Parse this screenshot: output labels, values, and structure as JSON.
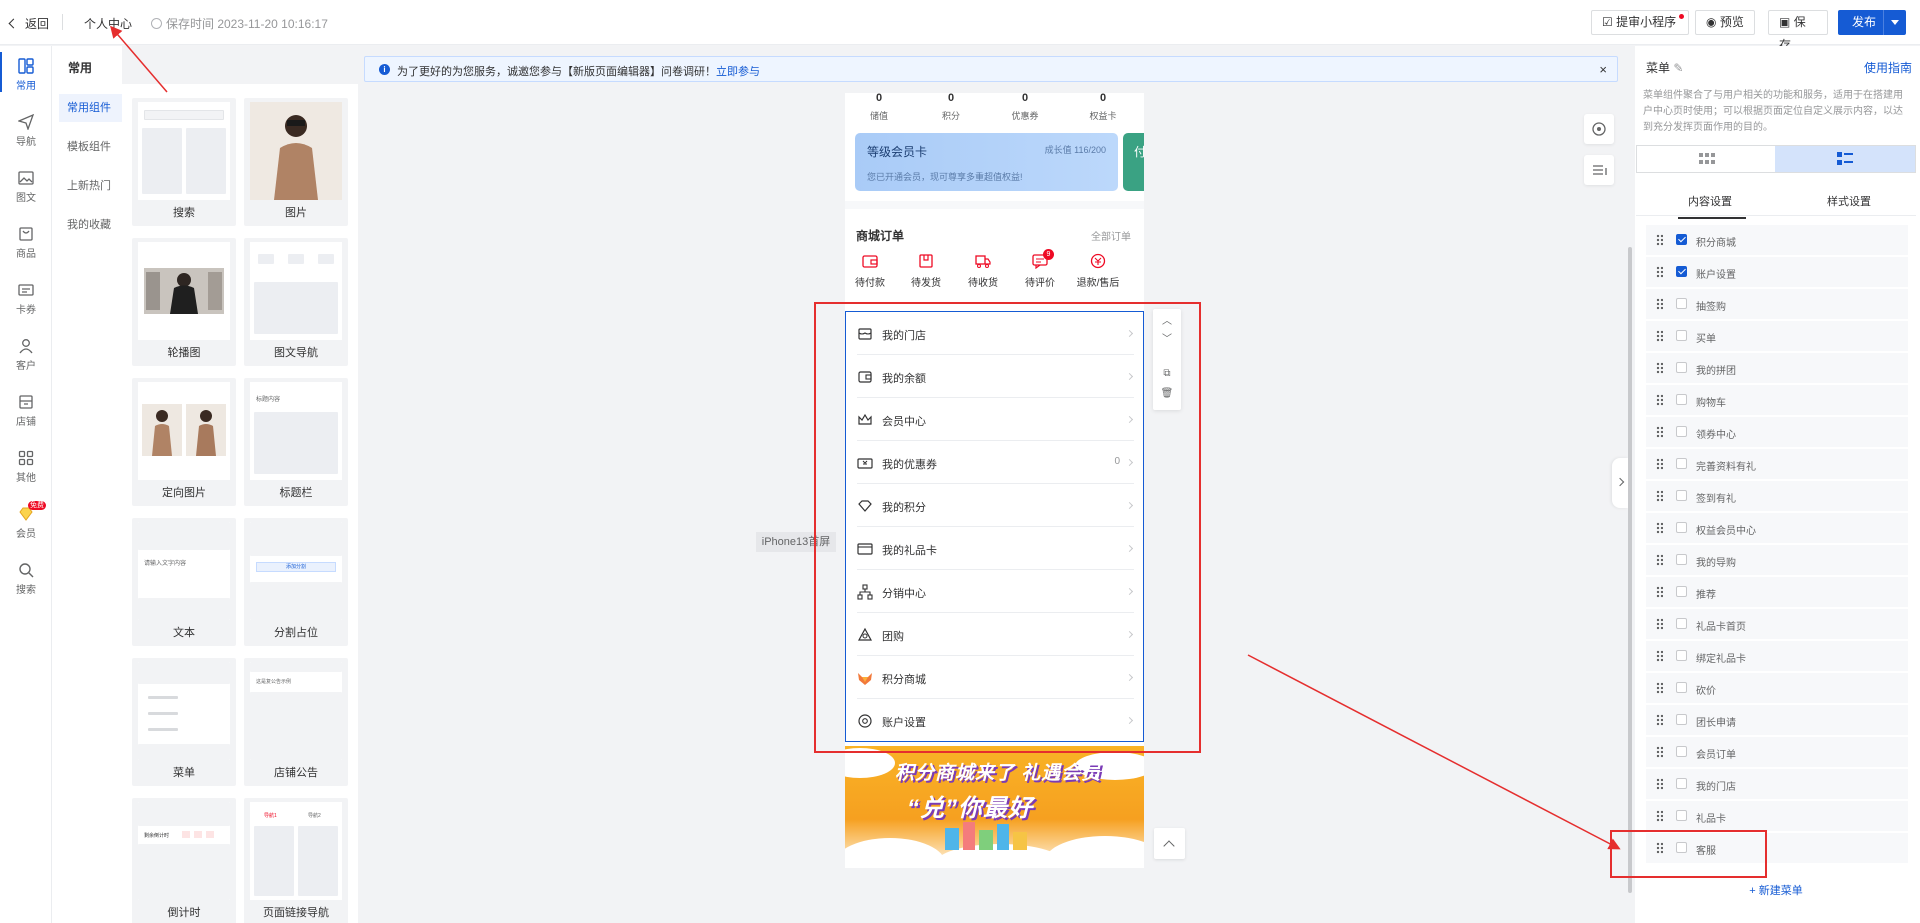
{
  "topbar": {
    "back": "返回",
    "page_name": "个人中心",
    "save_time": "保存时间 2023-11-20 10:16:17",
    "audit": "提审小程序",
    "preview": "预览",
    "save": "保存",
    "publish": "发布"
  },
  "nav": [
    "常用",
    "导航",
    "图文",
    "商品",
    "卡券",
    "客户",
    "店铺",
    "其他",
    "会员",
    "搜索"
  ],
  "nav_badge": "免费",
  "sub": {
    "title": "常用",
    "items": [
      "常用组件",
      "模板组件",
      "上新热门",
      "我的收藏"
    ]
  },
  "components": [
    "搜索",
    "图片",
    "轮播图",
    "图文导航",
    "定向图片",
    "标题栏",
    "文本",
    "分割占位",
    "菜单",
    "店铺公告",
    "倒计时",
    "页面链接导航"
  ],
  "component_snippets": {
    "title_bar": "标题内容",
    "text": "请输入文字内容",
    "divider": "添加分割",
    "notice": "这是复公告示例",
    "countdown": "剩余倒计时",
    "tab1": "导航1",
    "tab2": "导航2"
  },
  "notice": {
    "text": "为了更好的为您服务，诚邀您参与【新版页面编辑器】问卷调研！",
    "link": "立即参与",
    "close": "×"
  },
  "phone": {
    "stats": [
      {
        "value": "0",
        "label": "储值"
      },
      {
        "value": "0",
        "label": "积分"
      },
      {
        "value": "0",
        "label": "优惠券"
      },
      {
        "value": "0",
        "label": "权益卡"
      }
    ],
    "level_card": {
      "title": "等级会员卡",
      "growth": "成长值 116/200",
      "sub": "您已开通会员，现可尊享多重超值权益!"
    },
    "level_card2": "付",
    "orders_title": "商城订单",
    "orders_all": "全部订单",
    "orders": [
      "待付款",
      "待发货",
      "待收货",
      "待评价",
      "退款/售后"
    ],
    "order_badge": "9",
    "menu": [
      {
        "label": "我的门店",
        "value": ""
      },
      {
        "label": "我的余额",
        "value": ""
      },
      {
        "label": "会员中心",
        "value": ""
      },
      {
        "label": "我的优惠券",
        "value": "0"
      },
      {
        "label": "我的积分",
        "value": ""
      },
      {
        "label": "我的礼品卡",
        "value": ""
      },
      {
        "label": "分销中心",
        "value": ""
      },
      {
        "label": "团购",
        "value": ""
      },
      {
        "label": "积分商城",
        "value": ""
      },
      {
        "label": "账户设置",
        "value": ""
      }
    ],
    "banner_line1": "积分商城来了 礼遇会员",
    "banner_line2": "“兑”你最好"
  },
  "device_label": "iPhone13首屏",
  "panel": {
    "title": "菜单",
    "guide": "使用指南",
    "desc": "菜单组件聚合了与用户相关的功能和服务，适用于在搭建用户中心页时使用；可以根据页面定位自定义展示内容，以达到充分发挥页面作用的目的。",
    "tabs": [
      "内容设置",
      "样式设置"
    ],
    "items": [
      {
        "label": "积分商城",
        "checked": true
      },
      {
        "label": "账户设置",
        "checked": true
      },
      {
        "label": "抽签购",
        "checked": false
      },
      {
        "label": "买单",
        "checked": false
      },
      {
        "label": "我的拼团",
        "checked": false
      },
      {
        "label": "购物车",
        "checked": false
      },
      {
        "label": "领券中心",
        "checked": false
      },
      {
        "label": "完善资料有礼",
        "checked": false
      },
      {
        "label": "签到有礼",
        "checked": false
      },
      {
        "label": "权益会员中心",
        "checked": false
      },
      {
        "label": "我的导购",
        "checked": false
      },
      {
        "label": "推荐",
        "checked": false
      },
      {
        "label": "礼品卡首页",
        "checked": false
      },
      {
        "label": "绑定礼品卡",
        "checked": false
      },
      {
        "label": "砍价",
        "checked": false
      },
      {
        "label": "团长申请",
        "checked": false
      },
      {
        "label": "会员订单",
        "checked": false
      },
      {
        "label": "我的门店",
        "checked": false
      },
      {
        "label": "礼品卡",
        "checked": false
      },
      {
        "label": "客服",
        "checked": false
      }
    ],
    "add": "+ 新建菜单"
  },
  "colors": {
    "primary": "#155bd4",
    "annotation": "#e52e2e"
  }
}
